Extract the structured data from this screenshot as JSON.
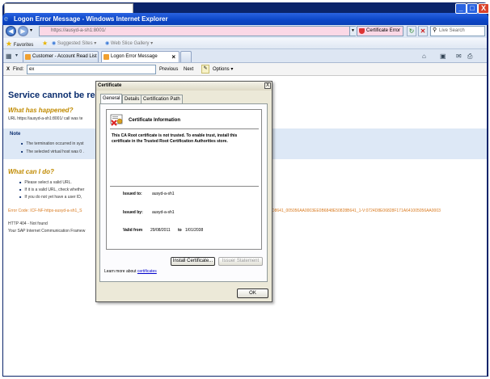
{
  "window": {
    "title": "Logon Error Message - Windows Internet Explorer",
    "controls": {
      "minimize": "_",
      "maximize": "□",
      "close": "X"
    }
  },
  "address_bar": {
    "url": "https://ausyd-a-sh1:8001/",
    "cert_error_label": "Certificate Error",
    "search_placeholder": "Live Search"
  },
  "favorites_bar": {
    "favorites_label": "Favorites",
    "items": [
      "Suggested Sites ▾",
      "Web Slice Gallery ▾"
    ]
  },
  "tabs": [
    {
      "label": "Customer - Account Read List",
      "active": false
    },
    {
      "label": "Logon Error Message",
      "active": true
    }
  ],
  "find_bar": {
    "close": "X",
    "label": "Find:",
    "value": "ex",
    "previous": "Previous",
    "next": "Next",
    "options": "Options ▾"
  },
  "page": {
    "heading": "Service cannot be rea",
    "what_happened": "What has happened?",
    "url_line": "URL https://ausyd-a-sh1:8001/ call was te",
    "note_title": "Note",
    "note_items": [
      "The termination occurred in syst",
      "The selected virtual host was 0 ."
    ],
    "what_can_i_do": "What can I do?",
    "can_do_items": [
      "Please select a valid URL.",
      "If it is a valid URL, check whether",
      "If you do not yet have a user ID,"
    ],
    "error_code_left": "Error Code: ICF-NF-https-ausyd-a-sh1_S",
    "error_code_right": "D8641_005056AA0003EE0B6848E50828B641_1-V:0724D8E06828F171A641005056AA0003",
    "http_status": "HTTP 404 - Not found",
    "sap_line": "Your SAP Internet Communication Framew"
  },
  "certificate_dialog": {
    "title": "Certificate",
    "close": "X",
    "tabs": [
      "General",
      "Details",
      "Certification Path"
    ],
    "heading": "Certificate Information",
    "message": "This CA Root certificate is not trusted. To enable trust, install this certificate in the Trusted Root Certification Authorities store.",
    "issued_to_label": "Issued to:",
    "issued_to_value": "ausyd-a-sh1",
    "issued_by_label": "Issued by:",
    "issued_by_value": "ausyd-a-sh1",
    "valid_from_label": "Valid from",
    "valid_from_value": "29/08/2011",
    "valid_to_label": "to",
    "valid_to_value": "1/01/2038",
    "install_button": "Install Certificate...",
    "issuer_button": "Issuer Statement",
    "learn_more_prefix": "Learn more about",
    "learn_more_link": "certificates",
    "ok_button": "OK"
  }
}
